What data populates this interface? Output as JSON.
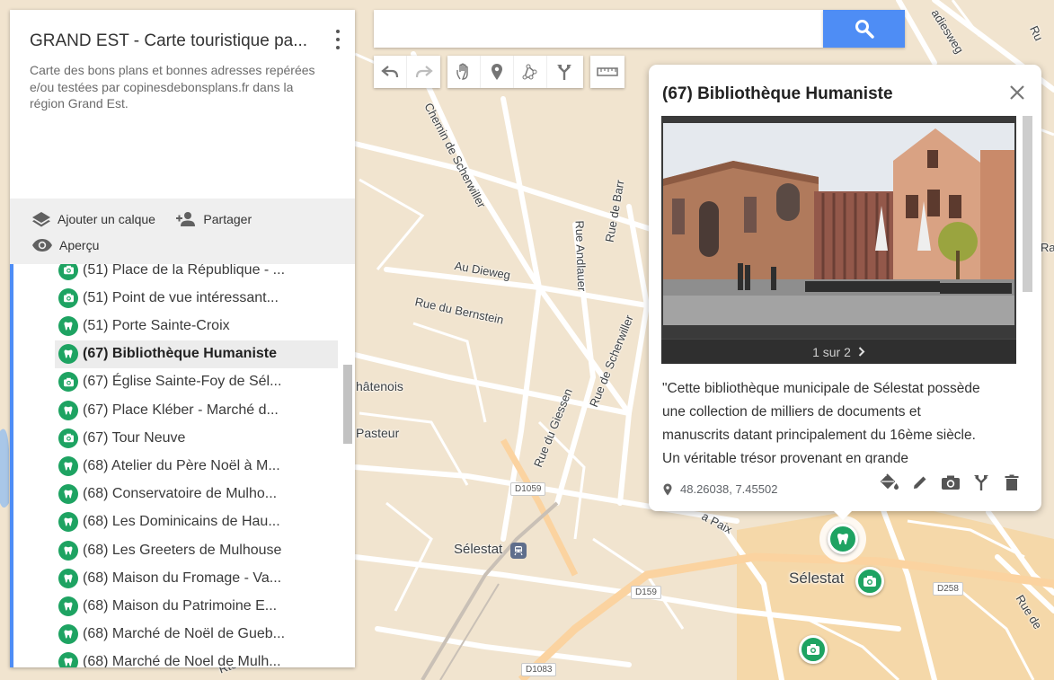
{
  "panel": {
    "title": "GRAND EST - Carte touristique pa...",
    "description": "Carte des bons plans et bonnes adresses repérées e/ou testées par copinesdebonsplans.fr dans la région Grand Est.",
    "actions": {
      "add_layer": "Ajouter un calque",
      "share": "Partager",
      "preview": "Aperçu"
    },
    "items": [
      {
        "label": "(51) Place de la République - ...",
        "icon": "camera-icon"
      },
      {
        "label": "(51) Point de vue intéressant...",
        "icon": "camera-icon"
      },
      {
        "label": "(51) Porte Sainte-Croix",
        "icon": "tooth-icon"
      },
      {
        "label": "(67) Bibliothèque Humaniste",
        "icon": "tooth-icon",
        "selected": true
      },
      {
        "label": "(67) Église Sainte-Foy de Sél...",
        "icon": "camera-icon"
      },
      {
        "label": "(67) Place Kléber - Marché d...",
        "icon": "tooth-icon"
      },
      {
        "label": "(67) Tour Neuve",
        "icon": "camera-icon"
      },
      {
        "label": "(68) Atelier du Père Noël à M...",
        "icon": "tooth-icon"
      },
      {
        "label": "(68) Conservatoire de Mulho...",
        "icon": "tooth-icon"
      },
      {
        "label": "(68) Les Dominicains de Hau...",
        "icon": "tooth-icon"
      },
      {
        "label": "(68) Les Greeters de Mulhouse",
        "icon": "tooth-icon"
      },
      {
        "label": "(68) Maison du Fromage - Va...",
        "icon": "tooth-icon"
      },
      {
        "label": "(68) Maison du Patrimoine E...",
        "icon": "tooth-icon"
      },
      {
        "label": "(68) Marché de Noël de Gueb...",
        "icon": "tooth-icon"
      },
      {
        "label": "(68) Marché de Noel de Mulh...",
        "icon": "tooth-icon"
      }
    ]
  },
  "search": {
    "placeholder": "",
    "value": ""
  },
  "toolbar": [
    "undo-icon",
    "redo-icon",
    "hand-icon",
    "marker-icon",
    "draw-line-icon",
    "directions-icon",
    "ruler-icon"
  ],
  "info_card": {
    "title": "(67) Bibliothèque Humaniste",
    "photo_counter": "1 sur 2",
    "description": "\"Cette bibliothèque municipale de Sélestat possède une collection de milliers de documents et manuscrits datant principalement du 16ème siècle. Un véritable trésor provenant en grande",
    "coordinates": "48.26038, 7.45502",
    "tools": [
      "paint-bucket-icon",
      "pencil-icon",
      "camera-icon",
      "directions-icon",
      "trash-icon"
    ]
  },
  "map": {
    "streets": {
      "chemin": "Chemin de Scherwiller",
      "andlauer": "Rue Andlauer",
      "barr": "Rue de Barr",
      "dieweg": "Au Dieweg",
      "bernstein": "Rue du Bernstein",
      "scherwiller": "Rue de Scherwiller",
      "giessen": "Rue du Giessen",
      "chatenois": "hâtenois",
      "pasteur": "Pasteur",
      "paix": "a Paix",
      "radiesweg": "adiesweg",
      "rue_top_right": "Ru",
      "rue_bottom_right": "Rue de",
      "rue_bottom_left": "Rte",
      "ra": "Ra"
    },
    "city": "Sélestat",
    "station": "Sélestat",
    "roads": {
      "d1059": "D1059",
      "d159": "D159",
      "d258": "D258",
      "d1083": "D1083"
    },
    "colors": {
      "land": "#f1e4cf",
      "road": "#ffffff",
      "highway": "#fbd3a0",
      "town": "#f6d49c",
      "marker": "#1ea362",
      "accent": "#4e8df5"
    }
  }
}
